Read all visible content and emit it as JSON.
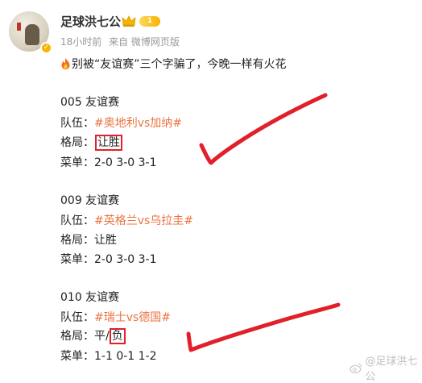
{
  "author": {
    "name": "足球洪七公",
    "level": "1"
  },
  "meta": {
    "time": "18小时前",
    "source": "来自 微博网页版"
  },
  "post": {
    "intro": "别被“友谊赛”三个字骗了，今晚一样有火花",
    "matches": [
      {
        "header": "005 友谊赛",
        "team_label": "队伍：",
        "teams": "#奥地利vs加纳#",
        "pattern_label": "格局：",
        "pattern": "让胜",
        "menu_label": "菜单：",
        "menu": "2-0 3-0 3-1"
      },
      {
        "header": "009 友谊赛",
        "team_label": "队伍：",
        "teams": "#英格兰vs乌拉圭#",
        "pattern_label": "格局：",
        "pattern": "让胜",
        "menu_label": "菜单：",
        "menu": "2-0 3-0 3-1"
      },
      {
        "header": "010 友谊赛",
        "team_label": "队伍：",
        "teams": "#瑞士vs德国#",
        "pattern_label": "格局：",
        "pattern_a": "平/",
        "pattern_b": "负",
        "menu_label": "菜单：",
        "menu": "1-1 0-1 1-2"
      }
    ]
  },
  "watermark": "@足球洪七公",
  "colors": {
    "topic": "#eb7340",
    "annotation_red": "#e0202a",
    "meta_gray": "#999999"
  },
  "icons": [
    "avatar",
    "verified-badge-icon",
    "crown-icon",
    "fire-icon",
    "weibo-logo-icon",
    "checkmark-annotation"
  ]
}
